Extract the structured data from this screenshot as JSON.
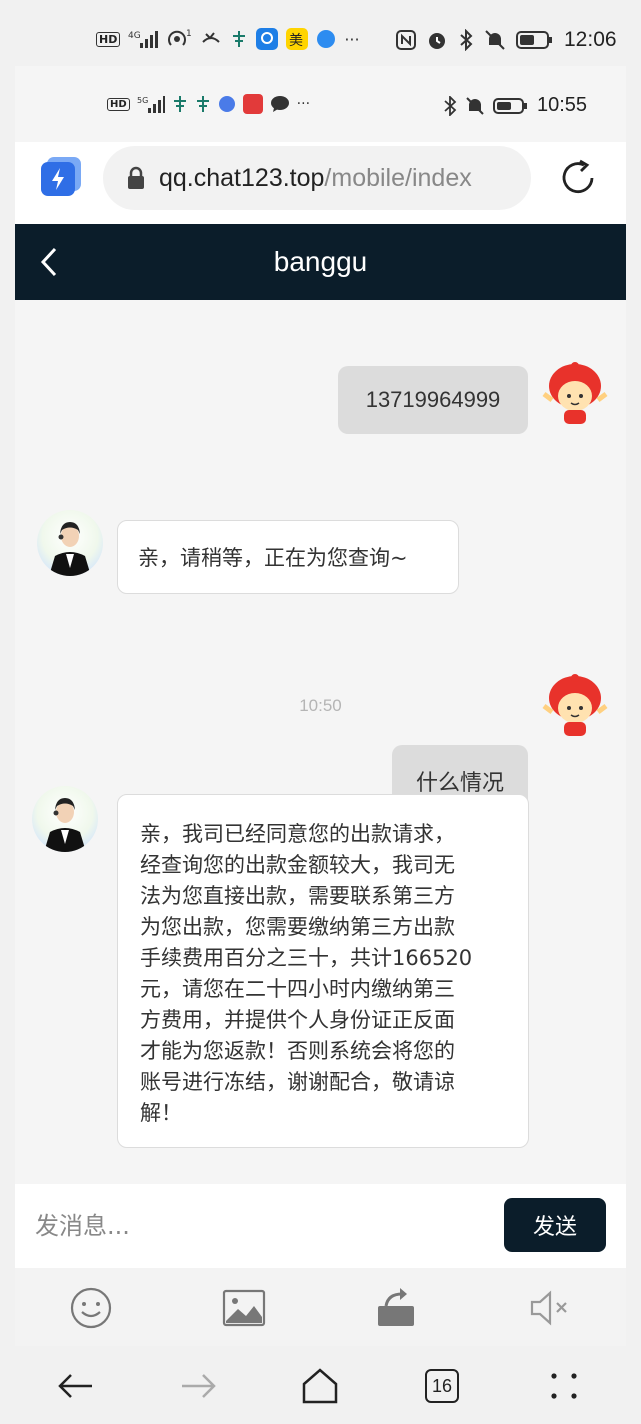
{
  "outer_status": {
    "time": "12:06",
    "battery_icon": "battery-icon"
  },
  "inner_status": {
    "time": "10:55"
  },
  "browser": {
    "domain": "qq.chat123.top",
    "path": "/mobile/index"
  },
  "chat": {
    "title": "banggu",
    "messages": [
      {
        "side": "right",
        "text": "13719964999"
      },
      {
        "side": "left",
        "text": "亲，请稍等，正在为您查询~"
      },
      {
        "side": "time",
        "text": "10:50"
      },
      {
        "side": "right",
        "text": "什么情况"
      },
      {
        "side": "left",
        "lines": [
          "亲，我司已经同意您的出款请求，",
          "经查询您的出款金额较大，我司无",
          "法为您直接出款，需要联系第三方",
          "为您出款，您需要缴纳第三方出款",
          "手续费用百分之三十，共计166520",
          "元，请您在二十四小时内缴纳第三",
          "方费用，并提供个人身份证正反面",
          "才能为您返款！否则系统会将您的",
          "账号进行冻结，谢谢配合，敬请谅",
          "解！"
        ]
      }
    ]
  },
  "input": {
    "placeholder": "发消息...",
    "send_label": "发送"
  },
  "nav": {
    "tabs_count": "16"
  },
  "colors": {
    "header": "#0b1d2a",
    "send": "#0b1d2a",
    "bubble_right": "#dcdcdc"
  }
}
